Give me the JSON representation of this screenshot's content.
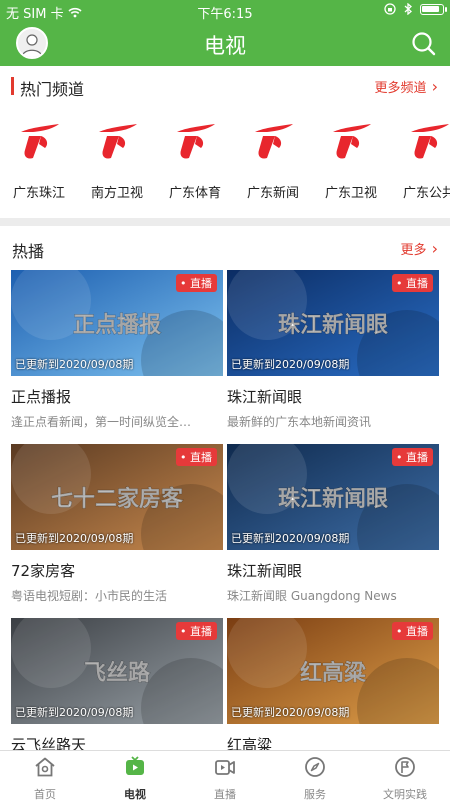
{
  "status_bar": {
    "carrier": "无 SIM 卡",
    "time": "下午6:15",
    "battery_level": 0.9
  },
  "header": {
    "title": "电视",
    "avatar_icon": "user-avatar-icon",
    "search_icon": "search-icon"
  },
  "hot_channels": {
    "title": "热门频道",
    "more": "更多频道",
    "items": [
      {
        "name": "广东珠江"
      },
      {
        "name": "南方卫视"
      },
      {
        "name": "广东体育"
      },
      {
        "name": "广东新闻"
      },
      {
        "name": "广东卫视"
      },
      {
        "name": "广东公共"
      }
    ]
  },
  "hot_play": {
    "title": "热播",
    "more": "更多",
    "badge": "直播",
    "items": [
      {
        "name": "正点播报",
        "desc": "逢正点看新闻，第一时间纵览全…",
        "update": "已更新到2020/09/08期",
        "thumb_text": "正点播报"
      },
      {
        "name": "珠江新闻眼",
        "desc": "最新鲜的广东本地新闻资讯",
        "update": "已更新到2020/09/08期",
        "thumb_text": "珠江新闻眼"
      },
      {
        "name": "72家房客",
        "desc": "粤语电视短剧：小市民的生活",
        "update": "已更新到2020/09/08期",
        "thumb_text": "七十二家房客"
      },
      {
        "name": "珠江新闻眼",
        "desc": "珠江新闻眼 Guangdong News",
        "update": "已更新到2020/09/08期",
        "thumb_text": "珠江新闻眼"
      },
      {
        "name": "云飞丝路天",
        "desc": "",
        "update": "已更新到2020/09/08期",
        "thumb_text": "飞丝路"
      },
      {
        "name": "红高粱",
        "desc": "",
        "update": "已更新到2020/09/08期",
        "thumb_text": "红高粱"
      }
    ]
  },
  "tabbar": {
    "items": [
      {
        "label": "首页",
        "icon": "home-icon"
      },
      {
        "label": "电视",
        "icon": "tv-icon"
      },
      {
        "label": "直播",
        "icon": "live-camera-icon"
      },
      {
        "label": "服务",
        "icon": "compass-icon"
      },
      {
        "label": "文明实践",
        "icon": "flag-icon"
      }
    ],
    "active_index": 1
  },
  "colors": {
    "brand_green": "#55b547",
    "accent_red": "#e23a2e",
    "live_red": "#e63a3a"
  }
}
